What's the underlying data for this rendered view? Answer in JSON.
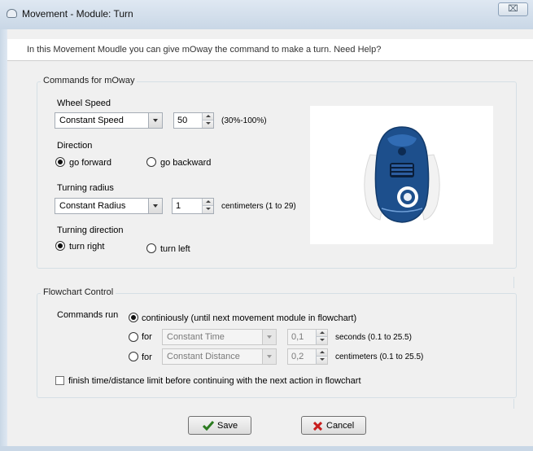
{
  "window": {
    "title": "Movement - Module: Turn",
    "close_glyph": "⌧"
  },
  "header": {
    "text": "In this Movement Moudle you can give mOway the command to make a turn. Need Help?"
  },
  "commands": {
    "group_title": "Commands for mOway",
    "wheel_speed": {
      "label": "Wheel Speed",
      "mode": "Constant Speed",
      "value": "50",
      "range": "(30%-100%)"
    },
    "direction": {
      "label": "Direction",
      "forward": "go forward",
      "backward": "go backward",
      "selected": "forward"
    },
    "turning_radius": {
      "label": "Turning radius",
      "mode": "Constant Radius",
      "value": "1",
      "unit": "centimeters (1 to 29)"
    },
    "turning_direction": {
      "label": "Turning direction",
      "right": "turn right",
      "left": "turn left",
      "selected": "right"
    },
    "image": {
      "icon": "moway-robot-icon",
      "colors": {
        "body": "#1d4f8c",
        "shell": "#f2f2f2"
      }
    }
  },
  "flowchart": {
    "group_title": "Flowchart Control",
    "commands_run_label": "Commands run",
    "continuous_option": "continiously (until next movement module in flowchart)",
    "for_label": "for",
    "time": {
      "mode": "Constant Time",
      "value": "0,1",
      "unit": "seconds (0.1 to 25.5)"
    },
    "distance": {
      "mode": "Constant Distance",
      "value": "0,2",
      "unit": "centimeters (0.1 to 25.5)"
    },
    "finish_checkbox": "finish time/distance limit before continuing with the next action in flowchart"
  },
  "buttons": {
    "save": "Save",
    "cancel": "Cancel",
    "colors": {
      "save_icon": "#2a7a1f",
      "cancel_icon": "#c81e1e"
    }
  }
}
